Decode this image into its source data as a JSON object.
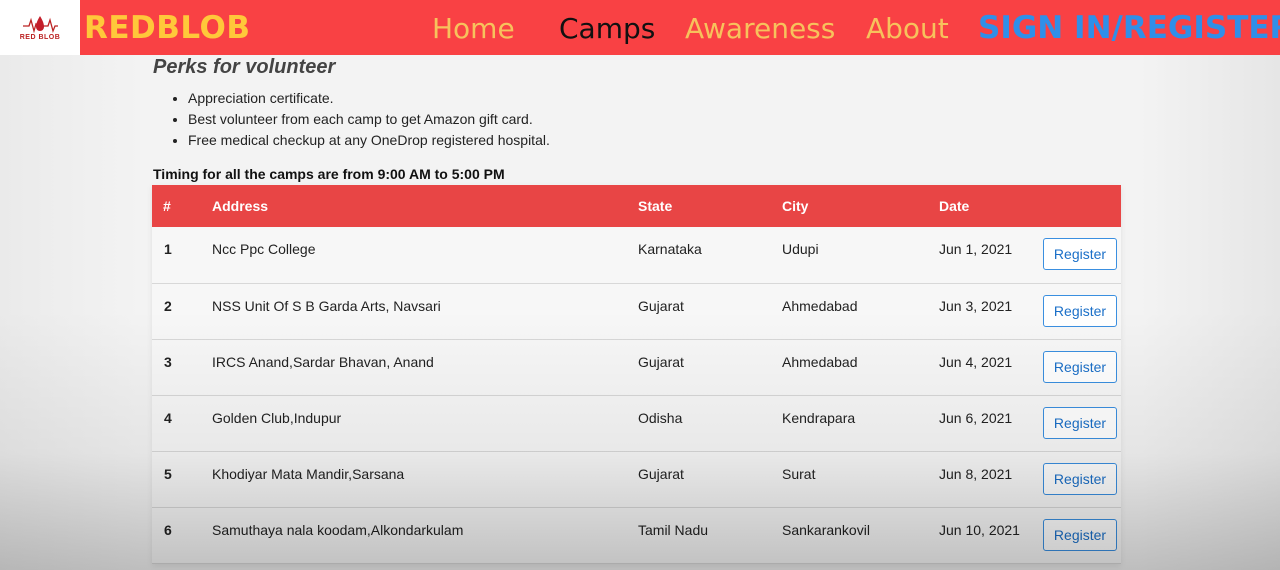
{
  "header": {
    "logo_text": "RED BLOB",
    "brand": "REDBLOB",
    "nav": {
      "home": "Home",
      "camps": "Camps",
      "awareness": "Awareness",
      "about": "About",
      "signin": "SIGN IN/REGISTER"
    }
  },
  "perks": {
    "title": "Perks for volunteer",
    "items": [
      "Appreciation certificate.",
      "Best volunteer from each camp to get Amazon gift card.",
      "Free medical checkup at any OneDrop registered hospital."
    ]
  },
  "timing": "Timing for all the camps are from 9:00 AM to 5:00 PM",
  "table": {
    "headers": [
      "#",
      "Address",
      "State",
      "City",
      "Date"
    ],
    "button_label": "Register",
    "rows": [
      {
        "num": "1",
        "address": "Ncc Ppc College",
        "state": "Karnataka",
        "city": "Udupi",
        "date": "Jun 1, 2021"
      },
      {
        "num": "2",
        "address": "NSS Unit Of S B Garda Arts, Navsari",
        "state": "Gujarat",
        "city": "Ahmedabad",
        "date": "Jun 3, 2021"
      },
      {
        "num": "3",
        "address": "IRCS Anand,Sardar Bhavan, Anand",
        "state": "Gujarat",
        "city": "Ahmedabad",
        "date": "Jun 4, 2021"
      },
      {
        "num": "4",
        "address": "Golden Club,Indupur",
        "state": "Odisha",
        "city": "Kendrapara",
        "date": "Jun 6, 2021"
      },
      {
        "num": "5",
        "address": "Khodiyar Mata Mandir,Sarsana",
        "state": "Gujarat",
        "city": "Surat",
        "date": "Jun 8, 2021"
      },
      {
        "num": "6",
        "address": "Samuthaya nala koodam,Alkondarkulam",
        "state": "Tamil Nadu",
        "city": "Sankarankovil",
        "date": "Jun 10, 2021"
      }
    ]
  },
  "colors": {
    "header_bg": "#f94144",
    "brand": "#ffc83a",
    "nav": "#f7c25c",
    "signin": "#2f8fe8",
    "table_header": "#e84545",
    "button_border": "#3a8fe0"
  }
}
